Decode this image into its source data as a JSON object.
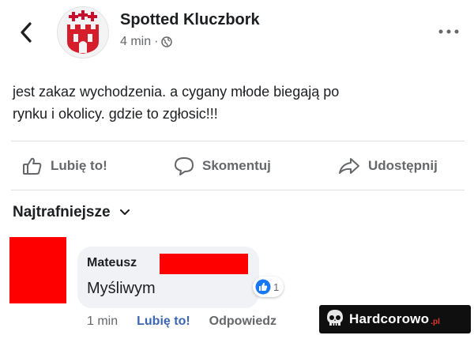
{
  "header": {
    "page_name": "Spotted Kluczbork",
    "time": "4 min",
    "separator": "·",
    "audience_icon": "globe-icon",
    "back_icon": "chevron-left-icon",
    "more_icon": "more-horizontal-icon"
  },
  "post": {
    "line1": "jest zakaz wychodzenia. a cygany młode biegają po",
    "line2": "rynku i okolicy. gdzie to zgłosic!!!"
  },
  "actions": {
    "like_label": "Lubię to!",
    "comment_label": "Skomentuj",
    "share_label": "Udostępnij"
  },
  "comments_sort": {
    "label": "Najtrafniejsze"
  },
  "comment": {
    "author": "Mateusz",
    "text": "Myśliwym",
    "reaction_count": "1",
    "time": "1 min",
    "like_label": "Lubię to!",
    "reply_label": "Odpowiedz",
    "redaction_color": "#fe0000"
  },
  "watermark": {
    "text": "Hardcorowo",
    "suffix": ".pl"
  },
  "colors": {
    "text": "#1c1e21",
    "secondary": "#65676b",
    "link": "#3b66b5",
    "like_blue": "#1877f2"
  }
}
